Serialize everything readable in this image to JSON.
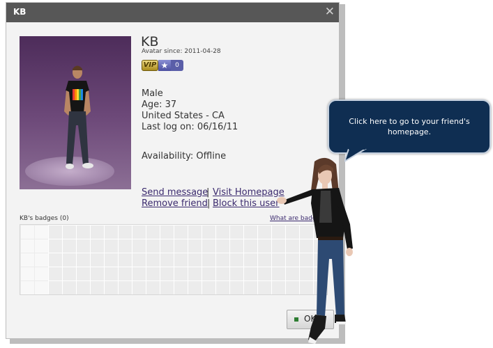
{
  "dialog": {
    "title": "KB",
    "close_glyph": "✕",
    "ok_label": "OK"
  },
  "profile": {
    "name": "KB",
    "avatar_since": "Avatar since: 2011-04-28",
    "vip_label": "VIP",
    "star_glyph": "★",
    "star_count": "0",
    "gender": "Male",
    "age": "Age: 37",
    "location": "United States - CA",
    "last_logon": "Last log on: 06/16/11",
    "availability": "Availability: Offline"
  },
  "actions": {
    "send_message": "Send message",
    "visit_homepage": "Visit Homepage",
    "remove_friend": "Remove friend",
    "block_user": "Block this user",
    "separator": "|"
  },
  "badges": {
    "label": "KB's badges (0)",
    "what_link": "What are badges?"
  },
  "tooltip": {
    "text": "Click here to go to your friend's homepage."
  },
  "icons": {
    "close": "close-icon",
    "star": "star-icon",
    "ok": "green-square-icon"
  },
  "colors": {
    "titlebar": "#575757",
    "link": "#3b2a6e",
    "bubble": "#0f2e52",
    "avatar_bg": "#6e4a7a",
    "vip_gold": "#d8b93f"
  }
}
